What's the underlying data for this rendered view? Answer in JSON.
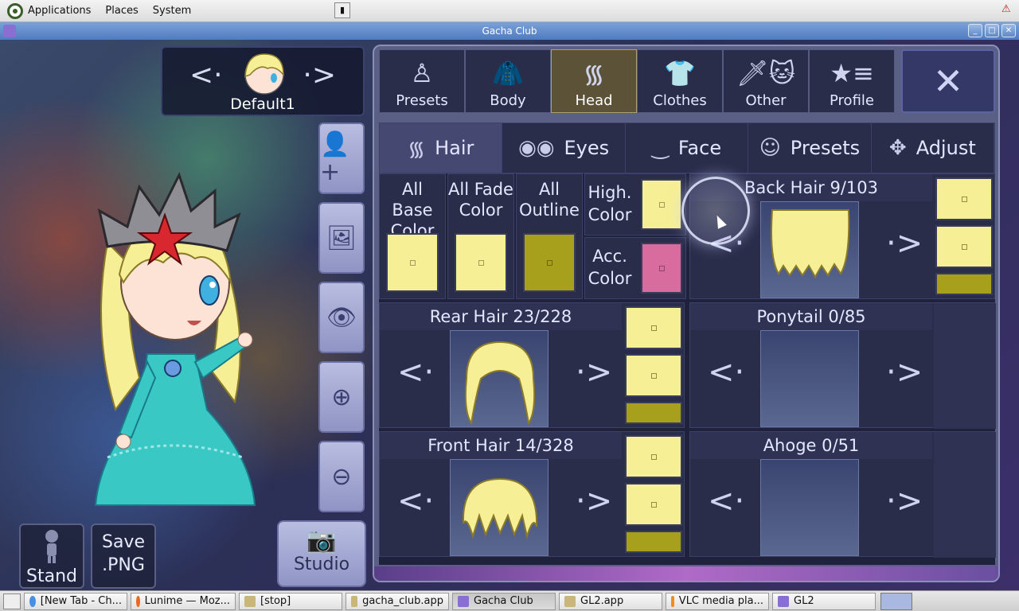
{
  "topbar": {
    "menus": [
      "Applications",
      "Places",
      "System"
    ]
  },
  "window": {
    "title": "Gacha Club"
  },
  "character": {
    "name": "Default1"
  },
  "bottom_buttons": {
    "stand": "Stand",
    "save_line1": "Save",
    "save_line2": ".PNG",
    "studio": "Studio"
  },
  "main_tabs": [
    {
      "label": "Presets",
      "icon": "person-silhouette-icon"
    },
    {
      "label": "Body",
      "icon": "jacket-icon"
    },
    {
      "label": "Head",
      "icon": "hair-icon"
    },
    {
      "label": "Clothes",
      "icon": "shirt-icon"
    },
    {
      "label": "Other",
      "icon": "sword-cat-icon"
    },
    {
      "label": "Profile",
      "icon": "star-list-icon"
    }
  ],
  "active_main_tab": "Head",
  "sub_tabs": [
    {
      "label": "Hair",
      "icon": "hair-icon"
    },
    {
      "label": "Eyes",
      "icon": "eyes-icon"
    },
    {
      "label": "Face",
      "icon": "face-icon"
    },
    {
      "label": "Presets",
      "icon": "head-presets-icon"
    },
    {
      "label": "Adjust",
      "icon": "move-arrows-icon"
    }
  ],
  "active_sub_tab": "Hair",
  "color_cells": {
    "all_base": {
      "line1": "All Base",
      "line2": "Color",
      "color": "#f7ef95"
    },
    "all_fade": {
      "line1": "All Fade",
      "line2": "Color",
      "color": "#f7ef95"
    },
    "all_outline": {
      "line1": "All",
      "line2": "Outline",
      "color": "#a7a01c"
    },
    "high": {
      "line1": "High.",
      "line2": "Color",
      "color": "#f7ef95"
    },
    "acc": {
      "line1": "Acc.",
      "line2": "Color",
      "color": "#d96c9e"
    }
  },
  "parts": {
    "back_hair": {
      "title": "Back Hair 9/103"
    },
    "rear_hair": {
      "title": "Rear Hair 23/228"
    },
    "ponytail": {
      "title": "Ponytail 0/85"
    },
    "front_hair": {
      "title": "Front Hair 14/328"
    },
    "ahoge": {
      "title": "Ahoge 0/51"
    }
  },
  "colors": {
    "hair_base": "#f7ef95",
    "hair_outline": "#a7a01c",
    "accessory": "#d96c9e",
    "active_tab": "#5c5238"
  },
  "taskbar": [
    {
      "label": "[New Tab - Ch...",
      "icon": "chrome-icon"
    },
    {
      "label": "Lunime — Moz...",
      "icon": "firefox-icon"
    },
    {
      "label": "[stop]",
      "icon": "folder-icon"
    },
    {
      "label": "gacha_club.app",
      "icon": "folder-icon"
    },
    {
      "label": "Gacha Club",
      "icon": "gacha-icon"
    },
    {
      "label": "GL2.app",
      "icon": "folder-icon"
    },
    {
      "label": "VLC media pla...",
      "icon": "vlc-icon"
    },
    {
      "label": "GL2",
      "icon": "gacha-icon"
    }
  ]
}
